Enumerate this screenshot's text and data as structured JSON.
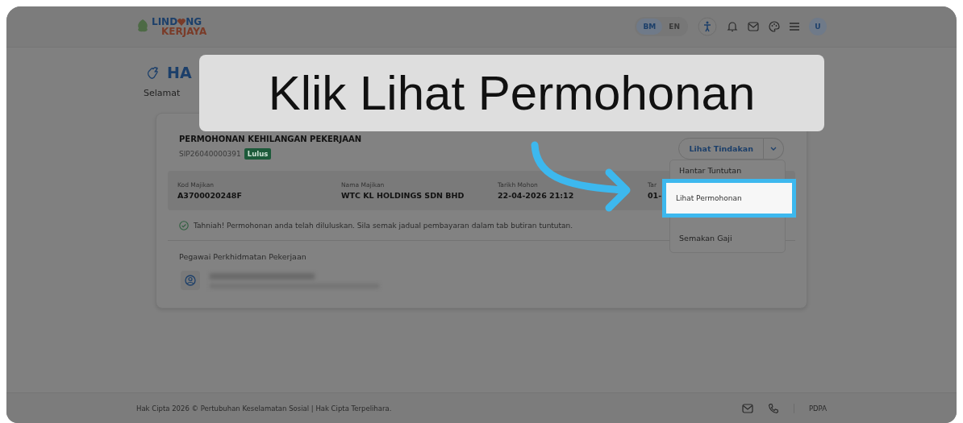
{
  "header": {
    "logo_top": [
      "LIND",
      "NG"
    ],
    "logo_bottom": "KERJAYA",
    "languages": [
      {
        "label": "BM",
        "selected": true
      },
      {
        "label": "EN",
        "selected": false
      }
    ],
    "avatar": "U"
  },
  "greeting": {
    "heading": "HA",
    "subtitle": "Selamat"
  },
  "application": {
    "title": "PERMOHONAN KEHILANGAN PEKERJAAN",
    "reference": "SIP26040000391",
    "status": "Lulus",
    "action_button": "Lihat Tindakan",
    "fields": [
      {
        "label": "Kod Majikan",
        "value": "A3700020248F"
      },
      {
        "label": "Nama Majikan",
        "value": "WTC KL HOLDINGS SDN BHD"
      },
      {
        "label": "Tarikh Mohon",
        "value": "22-04-2026 21:12"
      },
      {
        "label": "Tar",
        "value": "01-"
      }
    ],
    "notice": "Tahniah! Permohonan anda telah diluluskan. Sila semak jadual pembayaran dalam tab butiran tuntutan.",
    "officer_heading": "Pegawai Perkhidmatan Pekerjaan"
  },
  "action_menu": [
    {
      "label": "Hantar Tuntutan",
      "highlighted": false
    },
    {
      "label": "Lihat Permohonan",
      "highlighted": true
    },
    {
      "label": "Semakan Gaji",
      "highlighted": false
    }
  ],
  "callout": {
    "text": "Klik Lihat Permohonan"
  },
  "footer": {
    "copyright": "Hak Cipta 2026 © Pertubuhan Keselamatan Sosial | Hak Cipta Terpelihara.",
    "link": "PDPA"
  }
}
